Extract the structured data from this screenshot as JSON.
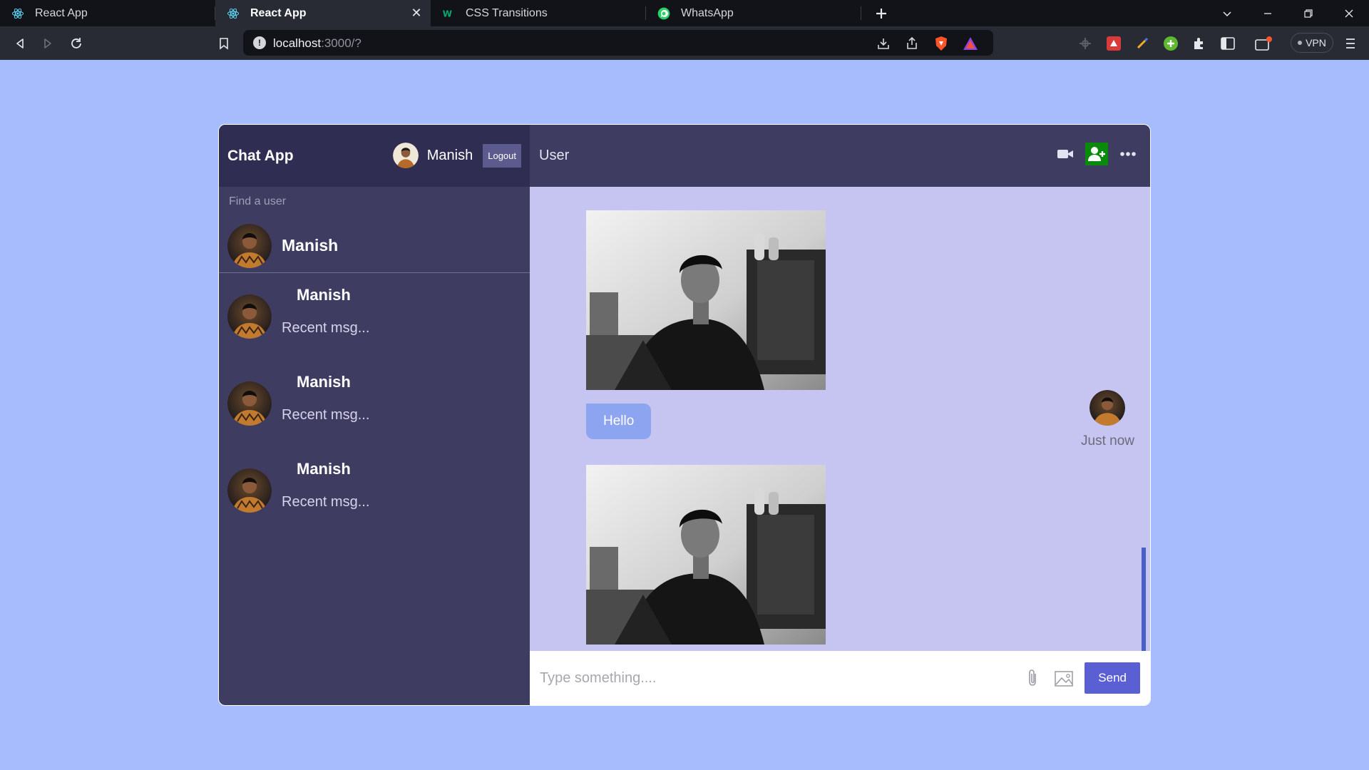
{
  "browser": {
    "tabs": [
      {
        "title": "React App",
        "icon": "react-icon",
        "active": false
      },
      {
        "title": "React App",
        "icon": "react-icon",
        "active": true
      },
      {
        "title": "CSS Transitions",
        "icon": "w3-icon",
        "active": false
      },
      {
        "title": "WhatsApp",
        "icon": "whatsapp-icon",
        "active": false
      }
    ],
    "url_host": "localhost",
    "url_path": ":3000/?",
    "vpn_label": "VPN"
  },
  "app": {
    "logo": "Chat App",
    "current_user": "Manish",
    "logout_label": "Logout",
    "search_placeholder": "Find a user",
    "found_user": "Manish",
    "chats": [
      {
        "name": "Manish",
        "last_message": "Recent msg..."
      },
      {
        "name": "Manish",
        "last_message": "Recent msg..."
      },
      {
        "name": "Manish",
        "last_message": "Recent msg..."
      }
    ],
    "chat_title": "User",
    "messages": [
      {
        "type": "image"
      },
      {
        "type": "text",
        "text": "Hello",
        "time": "Just now"
      },
      {
        "type": "image"
      }
    ],
    "input_placeholder": "Type something....",
    "send_label": "Send"
  },
  "colors": {
    "page_bg": "#a7bcfc",
    "sidebar_bg": "#3e3c61",
    "navbar_bg": "#2f2d52",
    "chat_bg": "#c6c4f0",
    "bubble_bg": "#8da4f1",
    "send_bg": "#5b5fd4",
    "add_user_bg": "#0a8a0a"
  }
}
